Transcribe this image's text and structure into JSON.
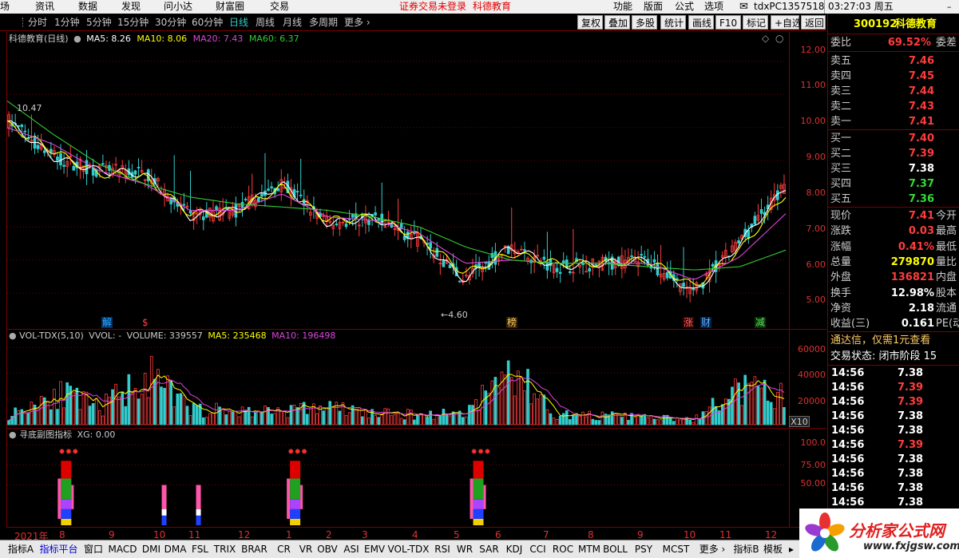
{
  "system_bar": {
    "menu_left": [
      "场",
      "资讯",
      "数据",
      "发现",
      "问小达",
      "财富圈",
      "交易"
    ],
    "notice": "证券交易未登录",
    "brand": "科德教育",
    "menu_right": [
      "功能",
      "版面",
      "公式",
      "选项"
    ],
    "account": "tdxPC1357518",
    "clock": "03:27:03 周五"
  },
  "period_bar": {
    "periods": [
      "分时",
      "1分钟",
      "5分钟",
      "15分钟",
      "30分钟",
      "60分钟",
      "日线",
      "周线",
      "月线",
      "多周期",
      "更多 ›"
    ],
    "active_period": "日线",
    "tools": [
      "复权",
      "叠加",
      "多股",
      "统计",
      "画线",
      "F10",
      "标记",
      "+自选",
      "返回"
    ]
  },
  "main_chart": {
    "title": "科德教育(日线)",
    "ma5": "MA5: 8.26",
    "ma10": "MA10: 8.06",
    "ma20": "MA20: 7.43",
    "ma60": "MA60: 6.37",
    "high_label": "10.47",
    "low_label": "←4.60",
    "ticks": [
      "12.00",
      "11.00",
      "10.00",
      "9.00",
      "8.00",
      "7.00",
      "6.00",
      "5.00"
    ],
    "event_marks": [
      {
        "text": "解",
        "color": "#33aaff"
      },
      {
        "text": "$",
        "color": "#ff4040"
      },
      {
        "text": "榜",
        "color": "#ffcc66"
      },
      {
        "text": "涨",
        "color": "#ff6666"
      },
      {
        "text": "财",
        "color": "#66aaff"
      },
      {
        "text": "减",
        "color": "#66dd66"
      }
    ]
  },
  "volume_chart": {
    "title": "VOL-TDX(5,10)",
    "vvol": "VVOL: -",
    "volume": "VOLUME: 339557",
    "ma5": "MA5: 235468",
    "ma10": "MA10: 196498",
    "ticks": [
      "60000",
      "40000",
      "20000"
    ],
    "unit": "X10"
  },
  "indicator_chart": {
    "title": "寻底副图指标",
    "xg": "XG: 0.00",
    "ticks": [
      "100.0",
      "75.00",
      "50.00"
    ]
  },
  "x_axis": {
    "labels": [
      "2021年",
      "8",
      "9",
      "10",
      "11",
      "12",
      "1",
      "2",
      "3",
      "4",
      "5",
      "6",
      "7",
      "8",
      "9",
      "10",
      "11",
      "12"
    ]
  },
  "quote_panel": {
    "code": "300192",
    "name": "科德教育",
    "weibi_label": "委比",
    "weibi_value": "69.52%",
    "weicha_label": "委差",
    "sell": [
      {
        "label": "卖五",
        "price": "7.46"
      },
      {
        "label": "卖四",
        "price": "7.45"
      },
      {
        "label": "卖三",
        "price": "7.44"
      },
      {
        "label": "卖二",
        "price": "7.43"
      },
      {
        "label": "卖一",
        "price": "7.41"
      }
    ],
    "buy": [
      {
        "label": "买一",
        "price": "7.40",
        "color": "red"
      },
      {
        "label": "买二",
        "price": "7.39",
        "color": "red"
      },
      {
        "label": "买三",
        "price": "7.38",
        "color": "white"
      },
      {
        "label": "买四",
        "price": "7.37",
        "color": "green"
      },
      {
        "label": "买五",
        "price": "7.36",
        "color": "green"
      }
    ],
    "stats": [
      {
        "label": "现价",
        "value": "7.41",
        "color": "red",
        "right": "今开"
      },
      {
        "label": "涨跌",
        "value": "0.03",
        "color": "red",
        "right": "最高"
      },
      {
        "label": "涨幅",
        "value": "0.41%",
        "color": "red",
        "right": "最低"
      },
      {
        "label": "总量",
        "value": "279870",
        "color": "yellow",
        "right": "量比"
      },
      {
        "label": "外盘",
        "value": "136821",
        "color": "red",
        "right": "内盘"
      },
      {
        "label": "换手",
        "value": "12.98%",
        "color": "white",
        "right": "股本"
      },
      {
        "label": "净资",
        "value": "2.18",
        "color": "white",
        "right": "流通"
      },
      {
        "label": "收益(三)",
        "value": "0.161",
        "color": "white",
        "right": "PE(动"
      }
    ],
    "notice": "通达信，仅需1元查看",
    "trade_status": "交易状态: 闭市阶段 15",
    "ticks": [
      {
        "time": "14:56",
        "price": "7.38",
        "color": "white"
      },
      {
        "time": "14:56",
        "price": "7.39",
        "color": "red"
      },
      {
        "time": "14:56",
        "price": "7.39",
        "color": "red"
      },
      {
        "time": "14:56",
        "price": "7.38",
        "color": "white"
      },
      {
        "time": "14:56",
        "price": "7.38",
        "color": "white"
      },
      {
        "time": "14:56",
        "price": "7.39",
        "color": "red"
      },
      {
        "time": "14:56",
        "price": "7.38",
        "color": "white"
      },
      {
        "time": "14:56",
        "price": "7.38",
        "color": "white"
      },
      {
        "time": "14:56",
        "price": "7.38",
        "color": "white"
      },
      {
        "time": "14:56",
        "price": "7.38",
        "color": "white"
      }
    ]
  },
  "tab_bar": {
    "tabs": [
      "指标A",
      "指标平台",
      "窗口",
      "MACD",
      "DMI",
      "DMA",
      "FSL",
      "TRIX",
      "BRAR",
      "CR",
      "VR",
      "OBV",
      "ASI",
      "EMV",
      "VOL-TDX",
      "RSI",
      "WR",
      "SAR",
      "KDJ",
      "CCI",
      "ROC",
      "MTM",
      "BOLL",
      "PSY",
      "MCST",
      "更多 ›",
      "指标B",
      "模板"
    ],
    "active": "指标平台"
  },
  "watermark": {
    "cn": "分析家公式网",
    "url": "www.fxjgsw.com"
  },
  "colors": {
    "background": "#000000",
    "grid_red": "#7a0000",
    "up_red": "#ff3c3c",
    "down_cyan": "#33cccc",
    "ma5_white": "#ffffff",
    "ma10_yellow": "#ffff00",
    "ma20_magenta": "#dd44dd",
    "ma60_green": "#33cc33"
  },
  "chart_data": {
    "type": "line",
    "title": "科德教育(日线)",
    "x": [
      "2021-07",
      "2021-08",
      "2021-09",
      "2021-10",
      "2021-11",
      "2021-12",
      "2022-01",
      "2022-02",
      "2022-03",
      "2022-04",
      "2022-05",
      "2022-06",
      "2022-07",
      "2022-08",
      "2022-09",
      "2022-10",
      "2022-11",
      "2022-12"
    ],
    "series": [
      {
        "name": "MA5",
        "values": [
          10.2,
          9.1,
          8.7,
          8.6,
          7.3,
          7.5,
          8.3,
          7.1,
          7.3,
          6.6,
          5.4,
          6.4,
          5.8,
          5.9,
          6.0,
          5.0,
          6.5,
          8.2
        ]
      },
      {
        "name": "MA10",
        "values": [
          10.1,
          9.3,
          8.6,
          8.5,
          7.4,
          7.5,
          8.2,
          7.2,
          7.3,
          6.7,
          5.6,
          6.2,
          5.9,
          5.9,
          6.0,
          5.2,
          6.3,
          8.0
        ]
      },
      {
        "name": "MA20",
        "values": [
          10.0,
          9.5,
          8.7,
          8.3,
          7.5,
          7.5,
          8.0,
          7.3,
          7.2,
          6.8,
          5.9,
          6.0,
          5.9,
          5.9,
          5.9,
          5.4,
          6.1,
          7.4
        ]
      },
      {
        "name": "MA60",
        "values": [
          10.8,
          9.8,
          8.9,
          8.3,
          7.9,
          7.7,
          7.6,
          7.5,
          7.3,
          7.0,
          6.4,
          6.0,
          5.9,
          5.9,
          5.8,
          5.7,
          5.8,
          6.3
        ]
      }
    ],
    "ylim": [
      4.5,
      12.5
    ],
    "volume": [
      8000,
      30000,
      15000,
      45000,
      14000,
      12000,
      13000,
      16000,
      10000,
      9000,
      11000,
      50000,
      9000,
      8000,
      7000,
      4000,
      32000,
      26000
    ],
    "volume_ylim": [
      0,
      65000
    ],
    "indicator": {
      "ylim": [
        0,
        110
      ],
      "signal_columns": [
        1,
        6,
        10
      ]
    }
  }
}
